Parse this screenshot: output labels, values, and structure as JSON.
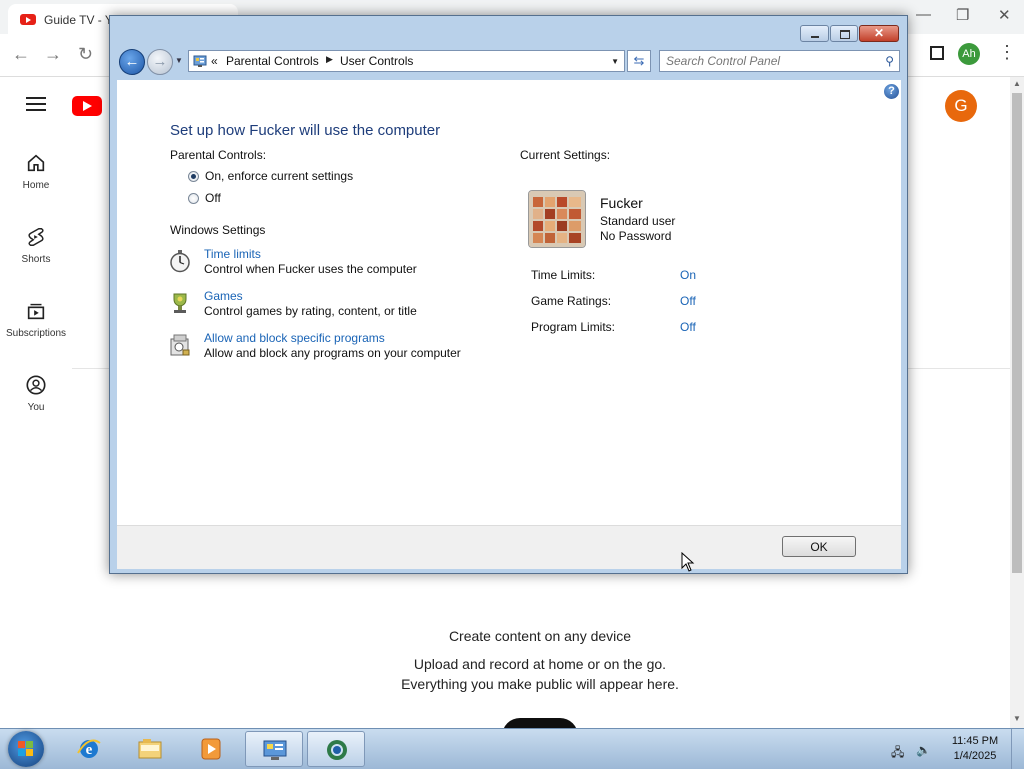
{
  "browser": {
    "tab_title": "Guide TV - YouTube",
    "profile_initial": "Ah",
    "window_buttons": {
      "minimize": "—",
      "restore": "❐",
      "close": "✕"
    }
  },
  "youtube": {
    "nav": [
      {
        "label": "Home",
        "icon": "home-icon"
      },
      {
        "label": "Shorts",
        "icon": "shorts-icon"
      },
      {
        "label": "Subscriptions",
        "icon": "subscriptions-icon"
      },
      {
        "label": "You",
        "icon": "you-icon"
      }
    ],
    "avatar_initial": "G",
    "promo": {
      "heading": "Create content on any device",
      "line1": "Upload and record at home or on the go.",
      "line2": "Everything you make public will appear here."
    }
  },
  "dialog": {
    "breadcrumb": [
      "Parental Controls",
      "User Controls"
    ],
    "breadcrumb_prefix": "«",
    "search_placeholder": "Search Control Panel",
    "help_label": "?",
    "title": "Set up how Fucker will use the computer",
    "parental_controls_label": "Parental Controls:",
    "radio_on": "On, enforce current settings",
    "radio_off": "Off",
    "radio_selected": "on",
    "windows_settings_label": "Windows Settings",
    "settings": [
      {
        "link": "Time limits",
        "description": "Control when Fucker uses the computer",
        "icon": "stopwatch-icon"
      },
      {
        "link": "Games",
        "description": "Control games by rating, content, or title",
        "icon": "games-trophy-icon"
      },
      {
        "link": "Allow and block specific programs",
        "description": "Allow and block any programs on your computer",
        "icon": "programs-icon"
      }
    ],
    "current_settings_label": "Current Settings:",
    "user": {
      "name": "Fucker",
      "account_type": "Standard user",
      "password_status": "No Password"
    },
    "current_settings": [
      {
        "label": "Time Limits:",
        "value": "On"
      },
      {
        "label": "Game Ratings:",
        "value": "Off"
      },
      {
        "label": "Program Limits:",
        "value": "Off"
      }
    ],
    "ok_label": "OK",
    "close_glyph": "✕"
  },
  "taskbar": {
    "items": [
      {
        "icon": "internet-explorer-icon",
        "active": false
      },
      {
        "icon": "windows-explorer-icon",
        "active": false
      },
      {
        "icon": "media-player-icon",
        "active": false
      },
      {
        "icon": "control-panel-icon",
        "active": true
      },
      {
        "icon": "chrome-icon",
        "active": true
      }
    ],
    "time": "11:45 PM",
    "date": "1/4/2025"
  },
  "colors": {
    "link": "#1a64b6",
    "title": "#1e3d7b",
    "dialog_frame": "#b9d1ea",
    "youtube_red": "#ff0000"
  }
}
